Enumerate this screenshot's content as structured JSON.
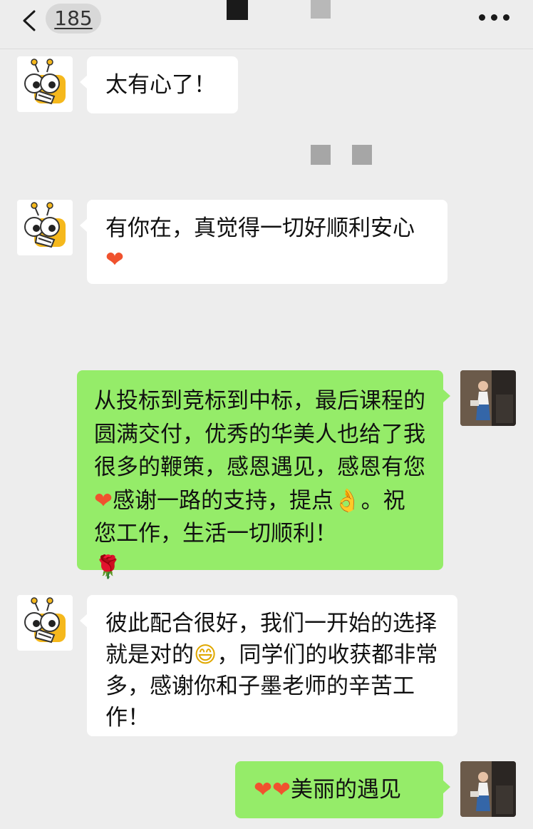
{
  "header": {
    "unread_count": "185",
    "back_icon": "chevron-left-icon",
    "more_icon": "more-dots-icon"
  },
  "messages": [
    {
      "side": "in",
      "text": "太有心了！"
    },
    {
      "side": "in",
      "text": "有你在，真觉得一切好顺利安心",
      "emoji": "❤"
    },
    {
      "side": "out",
      "text_1": "从投标到竞标到中标，最后课程的圆满交付，优秀的华美人也给了我很多的鞭策，感恩遇见，感恩有您",
      "emoji_1": "❤",
      "text_2": "感谢一路的支持，提点",
      "emoji_2": "👌",
      "text_3": "。祝您工作，生活一切顺利！",
      "emoji_3": "🌹"
    },
    {
      "side": "in",
      "text_1": "彼此配合很好，我们一开始的选择就是对的",
      "emoji": "😄",
      "text_2": "，同学们的收获都非常多，感谢你和子墨老师的辛苦工作！"
    },
    {
      "side": "out",
      "emoji": "❤❤",
      "text": "美丽的遇见"
    }
  ],
  "colors": {
    "background": "#ededed",
    "incoming_bubble": "#ffffff",
    "outgoing_bubble": "#95ec69",
    "heart": "#f0522e"
  },
  "avatars": {
    "contact": "bee-mascot-avatar",
    "self": "user-photo-avatar"
  }
}
